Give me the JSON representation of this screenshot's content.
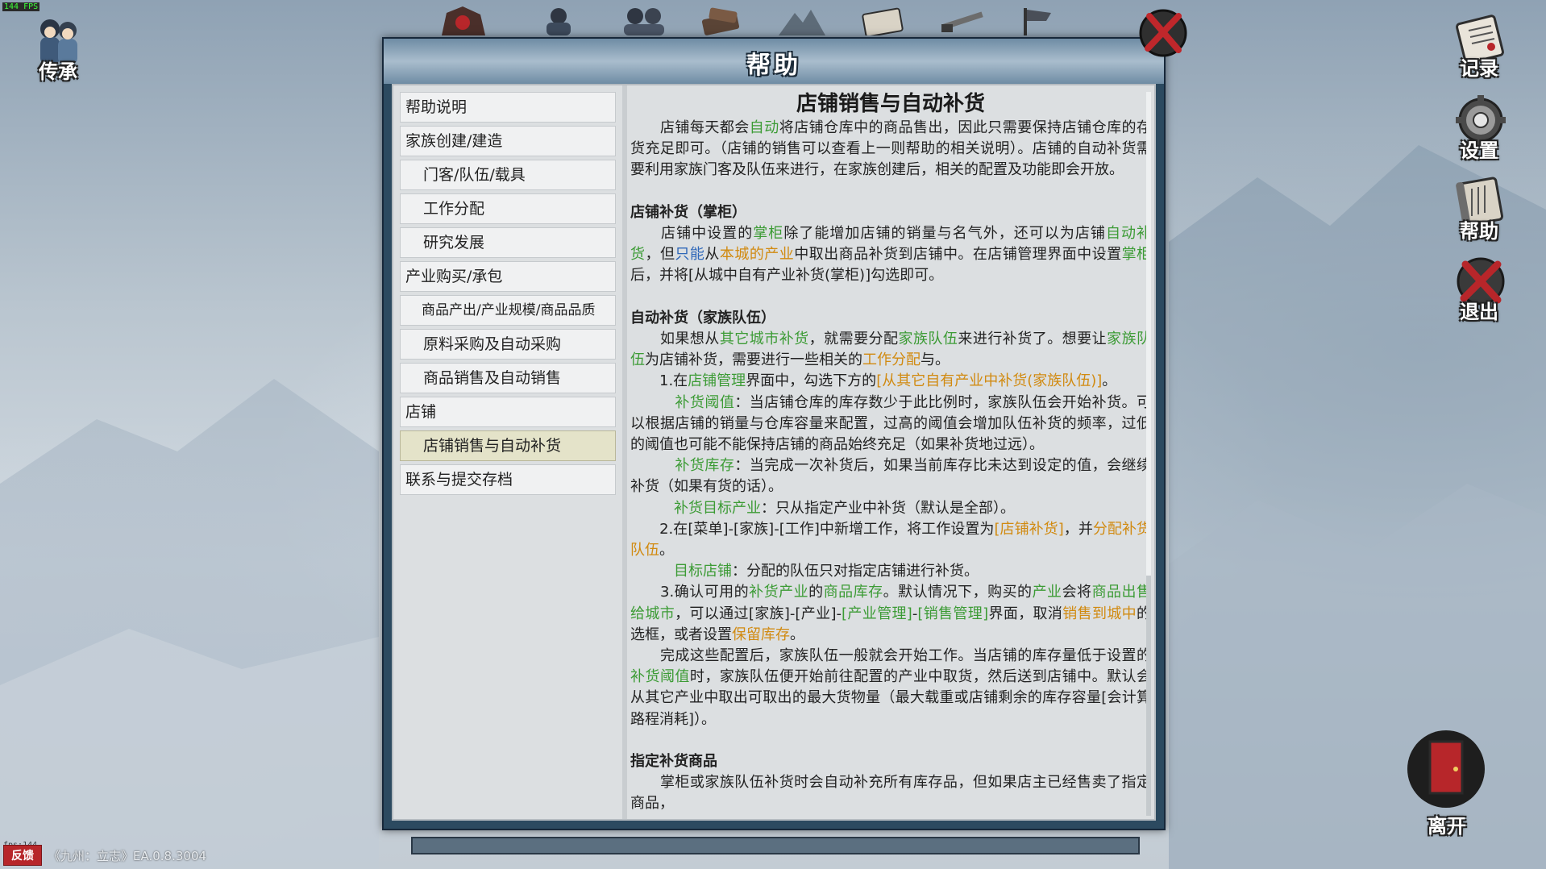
{
  "hud": {
    "fps_top": "144 FPS",
    "fps_bottom": "fps:144",
    "feedback_label": "反馈",
    "version": "《九州：立志》EA.0.8.3004",
    "inherit_label": "传承",
    "records_label": "记录",
    "settings_label": "设置",
    "help_label": "帮助",
    "quit_label": "退出",
    "leave_label": "离开"
  },
  "panel": {
    "title": "帮助"
  },
  "sidebar": {
    "items": [
      {
        "label": "帮助说明"
      },
      {
        "label": "家族创建/建造"
      },
      {
        "label": "门客/队伍/载具"
      },
      {
        "label": "工作分配"
      },
      {
        "label": "研究发展"
      },
      {
        "label": "产业购买/承包"
      },
      {
        "label": "商品产出/产业规模/商品品质"
      },
      {
        "label": "原料采购及自动采购"
      },
      {
        "label": "商品销售及自动销售"
      },
      {
        "label": "店铺"
      },
      {
        "label": "店铺销售与自动补货"
      },
      {
        "label": "联系与提交存档"
      }
    ]
  },
  "article": {
    "title": "店铺销售与自动补货",
    "p1": [
      {
        "t": "　　店铺每天都会"
      },
      {
        "t": "自动",
        "c": "g"
      },
      {
        "t": "将店铺仓库中的商品售出，因此只需要保持店铺仓库的存货充足即可。（店铺的销售可以查看上一则帮助的相关说明）。店铺的自动补货需要利用家族门客及队伍来进行，在家族创建后，相关的配置及功能即会开放。"
      }
    ],
    "h_shopkeeper": "店铺补货（掌柜）",
    "p2": [
      {
        "t": "　　店铺中设置的"
      },
      {
        "t": "掌柜",
        "c": "g"
      },
      {
        "t": "除了能增加店铺的销量与名气外，还可以为店铺"
      },
      {
        "t": "自动补货",
        "c": "g"
      },
      {
        "t": "，但"
      },
      {
        "t": "只能",
        "c": "b"
      },
      {
        "t": "从"
      },
      {
        "t": "本城的产业",
        "c": "o"
      },
      {
        "t": "中取出商品补货到店铺中。在店铺管理界面中设置"
      },
      {
        "t": "掌柜",
        "c": "g"
      },
      {
        "t": "后，并将[从城中自有产业补货(掌柜)]勾选即可。"
      }
    ],
    "h_team": "自动补货（家族队伍）",
    "p3": [
      {
        "t": "　　如果想从"
      },
      {
        "t": "其它城市补货",
        "c": "g"
      },
      {
        "t": "，就需要分配"
      },
      {
        "t": "家族队伍",
        "c": "g"
      },
      {
        "t": "来进行补货了。想要让"
      },
      {
        "t": "家族队伍",
        "c": "g"
      },
      {
        "t": "为店铺补货，需要进行一些相关的"
      },
      {
        "t": "工作分配",
        "c": "o"
      },
      {
        "t": "与。"
      }
    ],
    "p4": [
      {
        "t": "　　1.在"
      },
      {
        "t": "店铺管理",
        "c": "g"
      },
      {
        "t": "界面中，勾选下方的"
      },
      {
        "t": "[从其它自有产业中补货(家族队伍)]",
        "c": "o"
      },
      {
        "t": "。"
      }
    ],
    "p5": [
      {
        "t": "　　　"
      },
      {
        "t": "补货阈值",
        "c": "g"
      },
      {
        "t": "：当店铺仓库的库存数少于此比例时，家族队伍会开始补货。可以根据店铺的销量与仓库容量来配置，过高的阈值会增加队伍补货的频率，过低的阈值也可能不能保持店铺的商品始终充足（如果补货地过远）。"
      }
    ],
    "p6": [
      {
        "t": "　　　"
      },
      {
        "t": "补货库存",
        "c": "g"
      },
      {
        "t": "：当完成一次补货后，如果当前库存比未达到设定的值，会继续补货（如果有货的话）。"
      }
    ],
    "p7": [
      {
        "t": "　　　"
      },
      {
        "t": "补货目标产业",
        "c": "g"
      },
      {
        "t": "：只从指定产业中补货（默认是全部）。"
      }
    ],
    "p8": [
      {
        "t": "　　2.在[菜单]-[家族]-[工作]中新增工作，将工作设置为"
      },
      {
        "t": "[店铺补货]",
        "c": "o"
      },
      {
        "t": "，并"
      },
      {
        "t": "分配补货队伍",
        "c": "o"
      },
      {
        "t": "。"
      }
    ],
    "p9": [
      {
        "t": "　　　"
      },
      {
        "t": "目标店铺",
        "c": "g"
      },
      {
        "t": "：分配的队伍只对指定店铺进行补货。"
      }
    ],
    "p10": [
      {
        "t": "　　3.确认可用的"
      },
      {
        "t": "补货产业",
        "c": "g"
      },
      {
        "t": "的"
      },
      {
        "t": "商品库存",
        "c": "g"
      },
      {
        "t": "。默认情况下，购买的"
      },
      {
        "t": "产业",
        "c": "g"
      },
      {
        "t": "会将"
      },
      {
        "t": "商品出售给城市",
        "c": "g"
      },
      {
        "t": "，可以通过[家族]-[产业]-"
      },
      {
        "t": "[产业管理]",
        "c": "g"
      },
      {
        "t": "-"
      },
      {
        "t": "[销售管理]",
        "c": "g"
      },
      {
        "t": "界面，取消"
      },
      {
        "t": "销售到城中",
        "c": "o"
      },
      {
        "t": "的选框，或者设置"
      },
      {
        "t": "保留库存",
        "c": "o"
      },
      {
        "t": "。"
      }
    ],
    "p11": [
      {
        "t": "　　完成这些配置后，家族队伍一般就会开始工作。当店铺的库存量低于设置的"
      },
      {
        "t": "补货阈值",
        "c": "g"
      },
      {
        "t": "时，家族队伍便开始前往配置的产业中取货，然后送到店铺中。默认会从其它产业中取出可取出的最大货物量（最大载重或店铺剩余的库存容量[会计算路程消耗]）。"
      }
    ],
    "h_goods": "指定补货商品",
    "p12": [
      {
        "t": "　　掌柜或家族队伍补货时会自动补充所有库存品，但如果店主已经售卖了指定商品，"
      }
    ]
  },
  "colors": {
    "green": "#3c9b35",
    "orange": "#d18a10",
    "blue": "#2d66b8",
    "panel_dark": "#2c4a60",
    "active_item": "#e4e3c9"
  },
  "icons": {
    "top_bar": [
      "mask-icon",
      "scholar-icon",
      "family-icon",
      "books-icon",
      "mountain-icon",
      "scroll-icon",
      "sword-icon",
      "flag-icon"
    ],
    "close": "close-x-icon"
  }
}
